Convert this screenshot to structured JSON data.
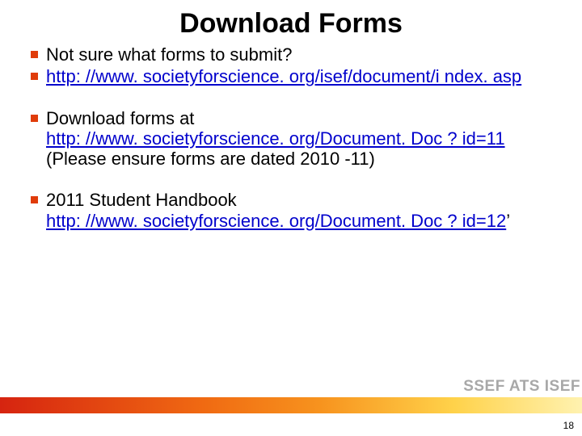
{
  "title": "Download Forms",
  "groups": [
    {
      "items": [
        {
          "pre": "Not sure what forms to submit?",
          "link": "",
          "post": ""
        },
        {
          "pre": "",
          "link": "http: //www. societyforscience. org/isef/document/i ndex. asp",
          "post": ""
        }
      ]
    },
    {
      "items": [
        {
          "pre": "Download forms at ",
          "link": "http: //www. societyforscience. org/Document. Doc ? id=11",
          "post_indent": "(Please ensure forms are dated 2010 -11)"
        }
      ]
    },
    {
      "items": [
        {
          "pre": "2011 Student Handbook ",
          "link": "http: //www. societyforscience. org/Document. Doc ? id=12",
          "post": "’"
        }
      ]
    }
  ],
  "footer_label": "SSEF ATS ISEF",
  "page_number": "18"
}
